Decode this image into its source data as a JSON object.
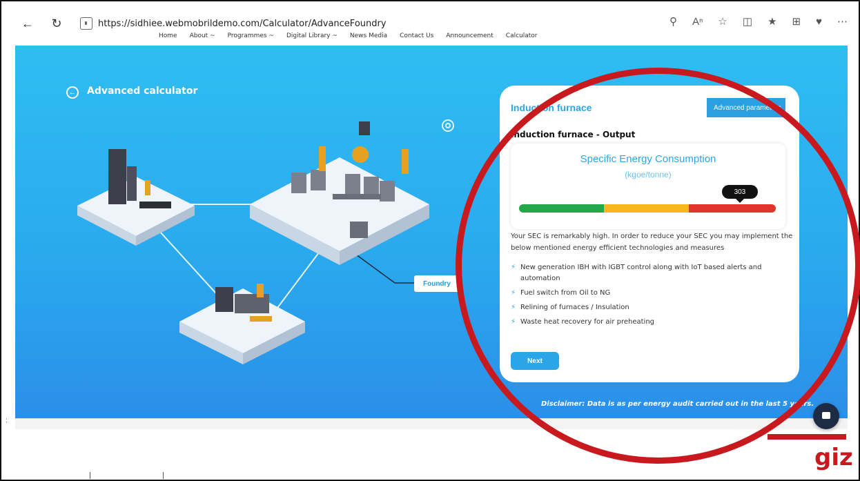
{
  "browser": {
    "url": "https://sidhiee.webmobrildemo.com/Calculator/AdvanceFoundry"
  },
  "site_nav": [
    "Home",
    "About ~",
    "Programmes ~",
    "Digital Library ~",
    "News Media",
    "Contact Us",
    "Announcement",
    "Calculator"
  ],
  "hero": {
    "title": "Advanced calculator",
    "foundry_label": "Foundry"
  },
  "card": {
    "title": "Induction furnace",
    "advanced_button": "Advanced parameters",
    "output_title": "Induction furnace - Output",
    "gauge": {
      "heading": "Specific Energy Consumption",
      "unit": "(kgoe/tonne)",
      "value": "303",
      "segments": [
        {
          "color": "#22a848",
          "fraction": 0.33
        },
        {
          "color": "#f7b71e",
          "fraction": 0.33
        },
        {
          "color": "#e0362b",
          "fraction": 0.34
        }
      ],
      "marker_fraction": 0.86
    },
    "description": "Your SEC is remarkably high. In order to reduce your SEC you may implement the below mentioned energy efficient technologies and measures",
    "measures": [
      "New generation IBH with IGBT control along with IoT based alerts and automation",
      "Fuel switch from Oil to NG",
      "Relining of furnaces / Insulation",
      "Waste heat recovery for air preheating"
    ],
    "next_button": "Next"
  },
  "disclaimer": "Disclaimer: Data is as per energy audit carried out in the last 5 years.",
  "logo": "giz",
  "colors": {
    "brand_blue": "#2aa6e8",
    "annotation_red": "#c8191f"
  }
}
